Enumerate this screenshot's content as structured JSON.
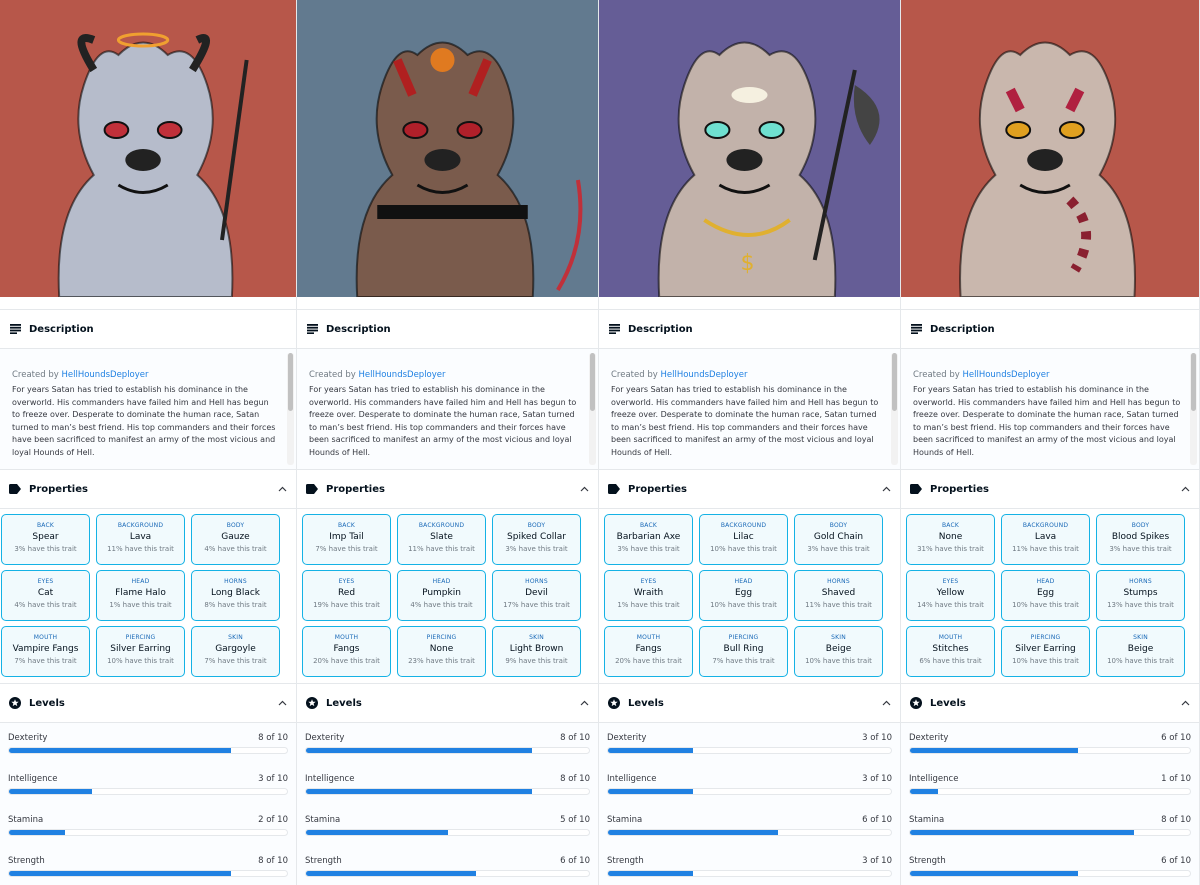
{
  "labels": {
    "description": "Description",
    "properties": "Properties",
    "levels": "Levels",
    "created_by": "Created by",
    "creator": "HellHoundsDeployer",
    "description_text": "For years Satan has tried to establish his dominance in the overworld. His commanders have failed him and Hell has begun to freeze over. Desperate to dominate the human race, Satan turned to man’s best friend. His top commanders and their forces have been sacrificed to manifest an army of the most vicious and loyal Hounds of Hell."
  },
  "icons": {
    "description": "description-lines-icon",
    "properties": "label-tag-icon",
    "levels": "star-circle-icon",
    "collapse": "chevron-up-icon"
  },
  "colors": {
    "accent": "#2081e2",
    "trait_border": "#15b2e5"
  },
  "panels": [
    {
      "bg": "#b7574a",
      "fur": "#b6bccb",
      "properties": [
        {
          "type": "BACK",
          "value": "Spear",
          "rarity": "3% have this trait"
        },
        {
          "type": "BACKGROUND",
          "value": "Lava",
          "rarity": "11% have this trait"
        },
        {
          "type": "BODY",
          "value": "Gauze",
          "rarity": "4% have this trait"
        },
        {
          "type": "EYES",
          "value": "Cat",
          "rarity": "4% have this trait"
        },
        {
          "type": "HEAD",
          "value": "Flame Halo",
          "rarity": "1% have this trait"
        },
        {
          "type": "HORNS",
          "value": "Long Black",
          "rarity": "8% have this trait"
        },
        {
          "type": "MOUTH",
          "value": "Vampire Fangs",
          "rarity": "7% have this trait"
        },
        {
          "type": "PIERCING",
          "value": "Silver Earring",
          "rarity": "10% have this trait"
        },
        {
          "type": "SKIN",
          "value": "Gargoyle",
          "rarity": "7% have this trait"
        }
      ],
      "levels": [
        {
          "name": "Dexterity",
          "value": 8,
          "max": 10,
          "text": "8 of 10"
        },
        {
          "name": "Intelligence",
          "value": 3,
          "max": 10,
          "text": "3 of 10"
        },
        {
          "name": "Stamina",
          "value": 2,
          "max": 10,
          "text": "2 of 10"
        },
        {
          "name": "Strength",
          "value": 8,
          "max": 10,
          "text": "8 of 10"
        }
      ]
    },
    {
      "bg": "#627a8f",
      "fur": "#7a5b4c",
      "properties": [
        {
          "type": "BACK",
          "value": "Imp Tail",
          "rarity": "7% have this trait"
        },
        {
          "type": "BACKGROUND",
          "value": "Slate",
          "rarity": "11% have this trait"
        },
        {
          "type": "BODY",
          "value": "Spiked Collar",
          "rarity": "3% have this trait"
        },
        {
          "type": "EYES",
          "value": "Red",
          "rarity": "19% have this trait"
        },
        {
          "type": "HEAD",
          "value": "Pumpkin",
          "rarity": "4% have this trait"
        },
        {
          "type": "HORNS",
          "value": "Devil",
          "rarity": "17% have this trait"
        },
        {
          "type": "MOUTH",
          "value": "Fangs",
          "rarity": "20% have this trait"
        },
        {
          "type": "PIERCING",
          "value": "None",
          "rarity": "23% have this trait"
        },
        {
          "type": "SKIN",
          "value": "Light Brown",
          "rarity": "9% have this trait"
        }
      ],
      "levels": [
        {
          "name": "Dexterity",
          "value": 8,
          "max": 10,
          "text": "8 of 10"
        },
        {
          "name": "Intelligence",
          "value": 8,
          "max": 10,
          "text": "8 of 10"
        },
        {
          "name": "Stamina",
          "value": 5,
          "max": 10,
          "text": "5 of 10"
        },
        {
          "name": "Strength",
          "value": 6,
          "max": 10,
          "text": "6 of 10"
        }
      ]
    },
    {
      "bg": "#655d96",
      "fur": "#c2b2aa",
      "properties": [
        {
          "type": "BACK",
          "value": "Barbarian Axe",
          "rarity": "3% have this trait"
        },
        {
          "type": "BACKGROUND",
          "value": "Lilac",
          "rarity": "10% have this trait"
        },
        {
          "type": "BODY",
          "value": "Gold Chain",
          "rarity": "3% have this trait"
        },
        {
          "type": "EYES",
          "value": "Wraith",
          "rarity": "1% have this trait"
        },
        {
          "type": "HEAD",
          "value": "Egg",
          "rarity": "10% have this trait"
        },
        {
          "type": "HORNS",
          "value": "Shaved",
          "rarity": "11% have this trait"
        },
        {
          "type": "MOUTH",
          "value": "Fangs",
          "rarity": "20% have this trait"
        },
        {
          "type": "PIERCING",
          "value": "Bull Ring",
          "rarity": "7% have this trait"
        },
        {
          "type": "SKIN",
          "value": "Beige",
          "rarity": "10% have this trait"
        }
      ],
      "levels": [
        {
          "name": "Dexterity",
          "value": 3,
          "max": 10,
          "text": "3 of 10"
        },
        {
          "name": "Intelligence",
          "value": 3,
          "max": 10,
          "text": "3 of 10"
        },
        {
          "name": "Stamina",
          "value": 6,
          "max": 10,
          "text": "6 of 10"
        },
        {
          "name": "Strength",
          "value": 3,
          "max": 10,
          "text": "3 of 10"
        }
      ]
    },
    {
      "bg": "#b7574a",
      "fur": "#c9b7ad",
      "properties": [
        {
          "type": "BACK",
          "value": "None",
          "rarity": "31% have this trait"
        },
        {
          "type": "BACKGROUND",
          "value": "Lava",
          "rarity": "11% have this trait"
        },
        {
          "type": "BODY",
          "value": "Blood Spikes",
          "rarity": "3% have this trait"
        },
        {
          "type": "EYES",
          "value": "Yellow",
          "rarity": "14% have this trait"
        },
        {
          "type": "HEAD",
          "value": "Egg",
          "rarity": "10% have this trait"
        },
        {
          "type": "HORNS",
          "value": "Stumps",
          "rarity": "13% have this trait"
        },
        {
          "type": "MOUTH",
          "value": "Stitches",
          "rarity": "6% have this trait"
        },
        {
          "type": "PIERCING",
          "value": "Silver Earring",
          "rarity": "10% have this trait"
        },
        {
          "type": "SKIN",
          "value": "Beige",
          "rarity": "10% have this trait"
        }
      ],
      "levels": [
        {
          "name": "Dexterity",
          "value": 6,
          "max": 10,
          "text": "6 of 10"
        },
        {
          "name": "Intelligence",
          "value": 1,
          "max": 10,
          "text": "1 of 10"
        },
        {
          "name": "Stamina",
          "value": 8,
          "max": 10,
          "text": "8 of 10"
        },
        {
          "name": "Strength",
          "value": 6,
          "max": 10,
          "text": "6 of 10"
        }
      ]
    }
  ]
}
